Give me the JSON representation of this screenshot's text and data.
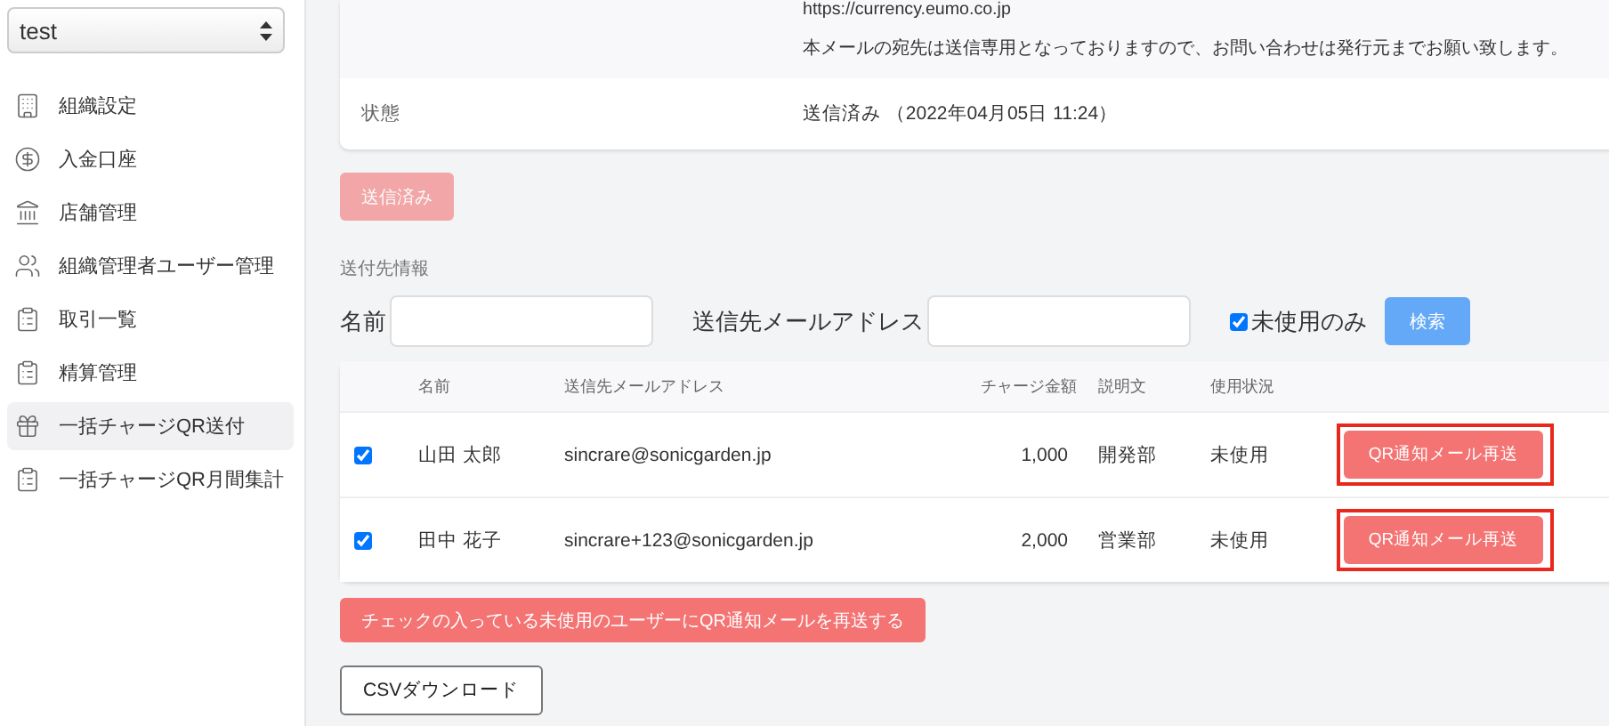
{
  "sidebar": {
    "select": {
      "value": "test"
    },
    "items": [
      {
        "label": "組織設定",
        "selected": false
      },
      {
        "label": "入金口座",
        "selected": false
      },
      {
        "label": "店舗管理",
        "selected": false
      },
      {
        "label": "組織管理者ユーザー管理",
        "selected": false
      },
      {
        "label": "取引一覧",
        "selected": false
      },
      {
        "label": "精算管理",
        "selected": false
      },
      {
        "label": "一括チャージQR送付",
        "selected": true
      },
      {
        "label": "一括チャージQR月間集計",
        "selected": false
      }
    ]
  },
  "detail": {
    "body_lines": [
      "https://currency.eumo.co.jp",
      "本メールの宛先は送信専用となっておりますので、お問い合わせは発行元までお願い致します。"
    ],
    "status_label": "状態",
    "status_value": "送信済み （2022年04月05日 11:24）"
  },
  "sent_button": {
    "label": "送信済み",
    "disabled": true
  },
  "recipients": {
    "heading": "送付先情報",
    "name_label": "名前",
    "email_label": "送信先メールアドレス",
    "unused_only": {
      "label": "未使用のみ",
      "checked": true
    },
    "search_button": "検索"
  },
  "table": {
    "columns": [
      "名前",
      "送信先メールアドレス",
      "チャージ金額",
      "説明文",
      "使用状況"
    ],
    "rows": [
      {
        "checked": true,
        "name": "山田 太郎",
        "email": "sincrare@sonicgarden.jp",
        "amount": "1,000",
        "description": "開発部",
        "status": "未使用",
        "action": "QR通知メール再送",
        "highlighted": true
      },
      {
        "checked": true,
        "name": "田中 花子",
        "email": "sincrare+123@sonicgarden.jp",
        "amount": "2,000",
        "description": "営業部",
        "status": "未使用",
        "action": "QR通知メール再送",
        "highlighted": true
      }
    ]
  },
  "bulk_button": "チェックの入っている未使用のユーザーにQR通知メールを再送する",
  "csv_button": "CSVダウンロード"
}
